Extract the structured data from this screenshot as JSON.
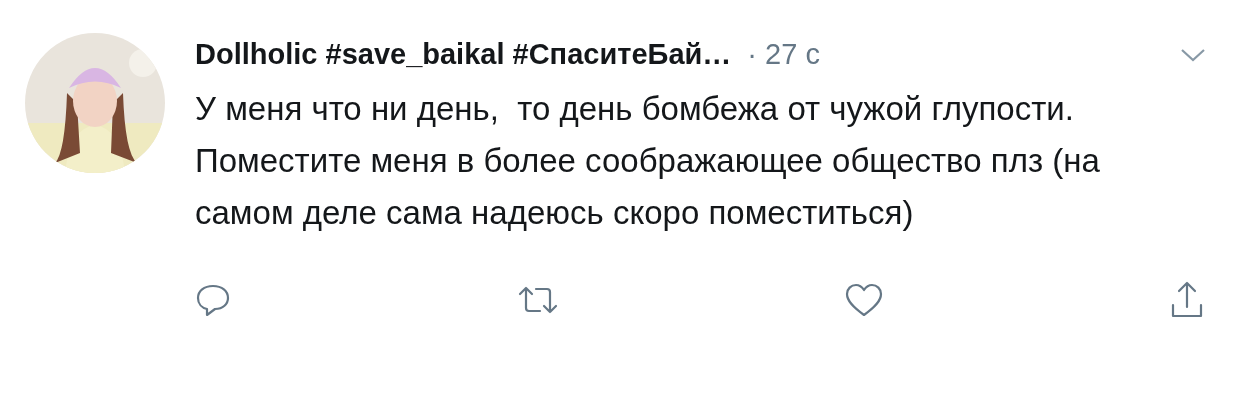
{
  "tweet": {
    "author": "Dollholic #save_baikal #СпаситеБай…",
    "time": "· 27 с",
    "text": "У меня что ни день,  то день бомбежа от чужой глупости. Поместите меня в более соображающее общество плз (на самом деле сама надеюсь скоро поместиться)",
    "actions": [
      {
        "kind": "reply"
      },
      {
        "kind": "retweet"
      },
      {
        "kind": "like"
      },
      {
        "kind": "share"
      }
    ]
  }
}
